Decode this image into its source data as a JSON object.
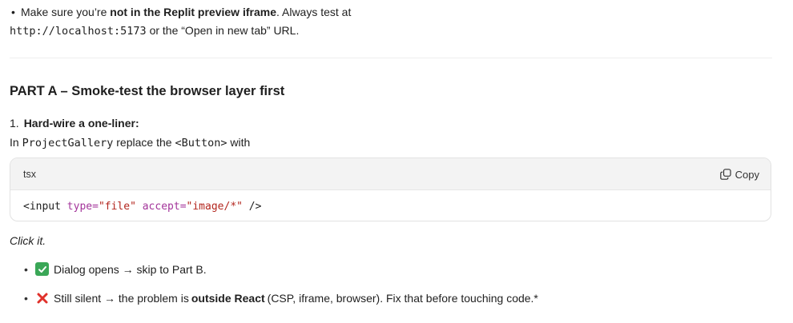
{
  "intro": {
    "bullet": "•",
    "make_sure_prefix": "Make sure you’re ",
    "not_in_replit": "not in the Replit preview iframe",
    "always_test_at": ". Always test at",
    "localhost_url": "http://localhost:5173",
    "or_open_new_tab": " or the “Open in new tab” URL."
  },
  "part_a": {
    "heading": "PART A – Smoke-test the browser layer first",
    "step_number": "1.",
    "step_title": "Hard-wire a one-liner:",
    "instr_in": "In ",
    "instr_component": "ProjectGallery",
    "instr_replace": " replace the ",
    "instr_button_tag": "<Button>",
    "instr_with": " with"
  },
  "code_block": {
    "language": "tsx",
    "copy_label": "Copy",
    "code_open": "<input ",
    "code_attr1": "type=",
    "code_val1": "\"file\"",
    "code_space": " ",
    "code_attr2": "accept=",
    "code_val2": "\"image/*\"",
    "code_close": " />"
  },
  "click_it": "Click it.",
  "results": [
    {
      "bullet": "•",
      "icon": "check-icon",
      "text": "Dialog opens → skip to Part B."
    },
    {
      "bullet": "•",
      "icon": "cross-icon",
      "text_prefix": "Still silent → the problem is ",
      "text_bold": "outside React",
      "text_suffix": " (CSP, iframe, browser). Fix that before touching code.*"
    }
  ],
  "colors": {
    "check_bg": "#3aa757",
    "cross": "#e0312b",
    "attr": "#a3349a",
    "string": "#b3261e"
  }
}
